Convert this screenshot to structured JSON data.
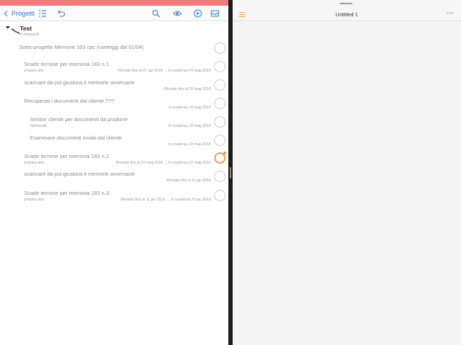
{
  "left": {
    "toolbar": {
      "back_label": "Progetti"
    },
    "project": {
      "title": "Test",
      "subtitle": "8 rimanenti"
    },
    "rows": [
      {
        "title": "Sotto-progetto Memorie 183 cpc (conteggi dal 01/04)",
        "note": "",
        "meta": "",
        "flag": false
      },
      {
        "title": "Scade termine per memoria 183 n.1",
        "note": "prepara atto",
        "meta": "Rinviato fino al 21 apr 2018 → In scadenza 01 mag 2018",
        "flag": false
      },
      {
        "title": "scaricare da pst.giustizia.it  memorie avversarie",
        "note": "",
        "meta": "Rinviato fino al 02 mag 2018",
        "flag": false
      },
      {
        "title": "Recuperati i documenti dal cliente ???",
        "note": "",
        "meta": "In scadenza 16 mag 2018",
        "flag": false
      },
      {
        "title": "Sentire cliente per documenti da produrre",
        "note": "Telefonate",
        "meta": "In scadenza 16 mag 2018",
        "flag": false
      },
      {
        "title": "Esaminare documenti inviati dal cliente",
        "note": "",
        "meta": "In scadenza 16 mag 2018",
        "flag": false
      },
      {
        "title": "Scade termine per memoria 183 n.2",
        "note": "prepara atto",
        "meta": "Rinviato fino al 21 mag 2018 → In scadenza 31 mag 2018",
        "flag": true
      },
      {
        "title": "scaricare da pst.giustizia.it  memorie avversarie",
        "note": "",
        "meta": "Rinviato fino al 11 giu 2018",
        "flag": false
      },
      {
        "title": "Scade termine per memoria 183 n.3",
        "note": "prepara atto",
        "meta": "Rinviato fino al 11 giu 2018 → In scadenza 20 giu 2018",
        "flag": false
      }
    ]
  },
  "right": {
    "title": "Untitled 1",
    "more_label": "•••"
  },
  "colors": {
    "accent": "#2f7be6",
    "flag": "#f39a3c",
    "statusbar": "#f07b7b"
  }
}
